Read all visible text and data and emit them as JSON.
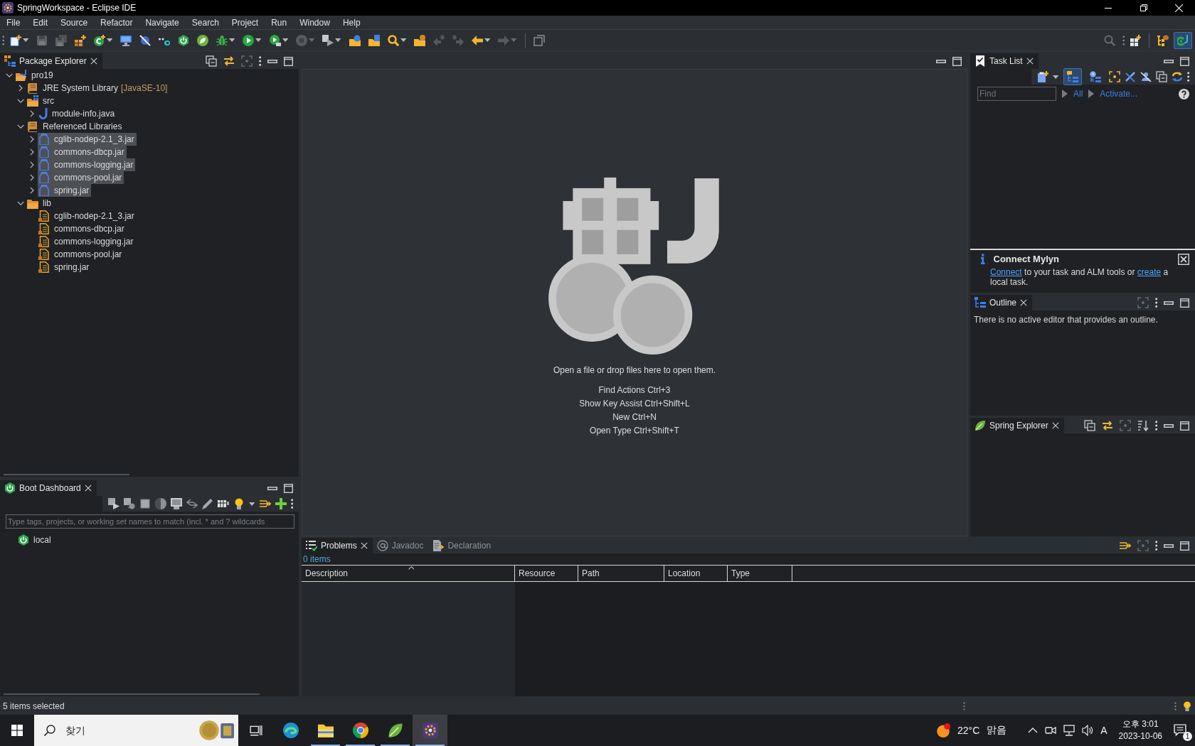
{
  "window": {
    "title": "SpringWorkspace - Eclipse IDE"
  },
  "menu": [
    "File",
    "Edit",
    "Source",
    "Refactor",
    "Navigate",
    "Search",
    "Project",
    "Run",
    "Window",
    "Help"
  ],
  "toolbar": [
    {
      "items": [
        {
          "kind": "new",
          "disabled": false,
          "menu": true
        },
        {
          "kind": "save",
          "disabled": true,
          "menu": false
        },
        {
          "kind": "save-all",
          "disabled": true,
          "menu": false
        },
        {
          "kind": "java-project",
          "disabled": false,
          "menu": false
        },
        {
          "kind": "new-class",
          "disabled": false,
          "menu": true
        },
        {
          "kind": "monitor",
          "disabled": false,
          "menu": false
        },
        {
          "kind": "skip-breakpoints",
          "disabled": false,
          "menu": false
        },
        {
          "kind": "toggle-dots",
          "disabled": false,
          "menu": false
        },
        {
          "kind": "boot",
          "disabled": false,
          "menu": false
        },
        {
          "kind": "spring",
          "disabled": false,
          "menu": false
        },
        {
          "kind": "debug",
          "disabled": false,
          "menu": true
        },
        {
          "kind": "run",
          "disabled": false,
          "menu": true
        },
        {
          "kind": "run-external",
          "disabled": false,
          "menu": true
        },
        {
          "kind": "stop",
          "disabled": true,
          "menu": true
        },
        {
          "kind": "next-annotation",
          "disabled": false,
          "menu": true
        },
        {
          "kind": "open-type",
          "disabled": false,
          "menu": false
        },
        {
          "kind": "open-task",
          "disabled": false,
          "menu": false
        },
        {
          "kind": "search",
          "disabled": false,
          "menu": true
        },
        {
          "kind": "open-resource",
          "disabled": false,
          "menu": false
        },
        {
          "kind": "last-edit",
          "disabled": true,
          "menu": false
        },
        {
          "kind": "next-edit",
          "disabled": true,
          "menu": false
        },
        {
          "kind": "back",
          "disabled": false,
          "menu": true
        },
        {
          "kind": "forward",
          "disabled": true,
          "menu": true
        }
      ]
    },
    {
      "items": [
        {
          "kind": "maximize-editor",
          "disabled": false,
          "menu": false
        }
      ]
    }
  ],
  "perspectives": [
    {
      "kind": "java",
      "selected": false
    },
    {
      "kind": "spring",
      "selected": true
    }
  ],
  "package_explorer": {
    "tab": {
      "label": "Package Explorer",
      "selected": true
    },
    "tree": [
      {
        "label": "pro19",
        "kind": "project",
        "expanded": true,
        "selected": false,
        "children": [
          {
            "label": "JRE System Library",
            "decoration": "[JavaSE-10]",
            "kind": "library",
            "expanded": false,
            "selected": false
          },
          {
            "label": "src",
            "kind": "source-folder",
            "expanded": true,
            "selected": false,
            "children": [
              {
                "label": "module-info.java",
                "kind": "java-file",
                "expanded": false,
                "selected": false
              }
            ]
          },
          {
            "label": "Referenced Libraries",
            "kind": "library",
            "expanded": true,
            "selected": false,
            "children": [
              {
                "label": "cglib-nodep-2.1_3.jar",
                "kind": "jar",
                "expanded": false,
                "selected": true
              },
              {
                "label": "commons-dbcp.jar",
                "kind": "jar",
                "expanded": false,
                "selected": true
              },
              {
                "label": "commons-logging.jar",
                "kind": "jar",
                "expanded": false,
                "selected": true
              },
              {
                "label": "commons-pool.jar",
                "kind": "jar",
                "expanded": false,
                "selected": true
              },
              {
                "label": "spring.jar",
                "kind": "jar",
                "expanded": false,
                "selected": true
              }
            ]
          },
          {
            "label": "lib",
            "kind": "folder",
            "expanded": true,
            "selected": false,
            "children": [
              {
                "label": "cglib-nodep-2.1_3.jar",
                "kind": "jar-file",
                "selected": false
              },
              {
                "label": "commons-dbcp.jar",
                "kind": "jar-file",
                "selected": false
              },
              {
                "label": "commons-logging.jar",
                "kind": "jar-file",
                "selected": false
              },
              {
                "label": "commons-pool.jar",
                "kind": "jar-file",
                "selected": false
              },
              {
                "label": "spring.jar",
                "kind": "jar-file",
                "selected": false
              }
            ]
          }
        ]
      }
    ]
  },
  "boot_dashboard": {
    "tab": {
      "label": "Boot Dashboard",
      "selected": true
    },
    "filter": {
      "placeholder": "Type tags, projects, or working set names to match (incl. * and ? wildcards"
    },
    "targets": [
      {
        "label": "local",
        "selected": false
      }
    ]
  },
  "editor_area": {
    "message": "Open a file or drop files here to open them.",
    "hints": [
      "Find Actions Ctrl+3",
      "Show Key Assist Ctrl+Shift+L",
      "New Ctrl+N",
      "Open Type Ctrl+Shift+T"
    ]
  },
  "task_list": {
    "tab": {
      "label": "Task List",
      "selected": true
    },
    "presentations": [
      {
        "kind": "categorized",
        "selected": true
      },
      {
        "kind": "scheduled",
        "selected": false
      }
    ],
    "find": {
      "placeholder": "Find"
    },
    "filters": [
      "All",
      "Activate..."
    ]
  },
  "connect_mylyn": {
    "title": "Connect Mylyn",
    "message": [
      {
        "kind": "link",
        "text": "Connect"
      },
      {
        "kind": "text",
        "text": "to your task and ALM tools or"
      },
      {
        "kind": "link",
        "text": "create"
      },
      {
        "kind": "text",
        "text": "a local task."
      }
    ]
  },
  "outline": {
    "tab": {
      "label": "Outline",
      "selected": true
    },
    "message": "There is no active editor that provides an outline."
  },
  "spring_explorer": {
    "tab": {
      "label": "Spring Explorer",
      "selected": true
    }
  },
  "problems": {
    "tabs": [
      {
        "label": "Problems",
        "selected": true
      },
      {
        "label": "Javadoc",
        "selected": false
      },
      {
        "label": "Declaration",
        "selected": false
      }
    ],
    "summary": "0 items",
    "columns": [
      {
        "label": "Description",
        "sorted": true
      },
      {
        "label": "Resource",
        "sorted": false
      },
      {
        "label": "Path",
        "sorted": false
      },
      {
        "label": "Location",
        "sorted": false
      },
      {
        "label": "Type",
        "sorted": false
      }
    ]
  },
  "status_bar": {
    "message": "5 items selected"
  },
  "taskbar": {
    "search": {
      "placeholder": "찾기"
    },
    "apps": [
      {
        "kind": "edge",
        "running": false,
        "active": false
      },
      {
        "kind": "explorer",
        "running": true,
        "active": false
      },
      {
        "kind": "chrome",
        "running": true,
        "active": false
      },
      {
        "kind": "sts",
        "running": true,
        "active": false
      },
      {
        "kind": "eclipse",
        "running": true,
        "active": true
      }
    ],
    "weather": {
      "temperature": "22°C",
      "condition": "맑음"
    },
    "input_mode": "A",
    "clock": {
      "time": "오후 3:01",
      "date": "2023-10-06"
    },
    "notifications": "1"
  }
}
